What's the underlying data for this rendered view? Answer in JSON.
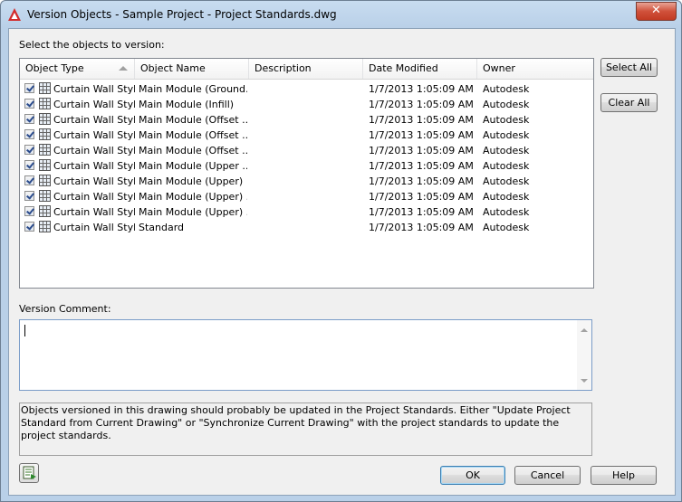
{
  "window": {
    "title": "Version Objects - Sample Project - Project Standards.dwg",
    "close_label": "✕"
  },
  "labels": {
    "select_objects": "Select the objects to version:",
    "version_comment": "Version Comment:"
  },
  "list": {
    "columns": [
      "Object Type",
      "Object Name",
      "Description",
      "Date Modified",
      "Owner"
    ],
    "rows": [
      {
        "type": "Curtain Wall Style",
        "name": "Main Module (Ground…",
        "description": "",
        "date": "1/7/2013 1:05:09 AM",
        "owner": "Autodesk",
        "checked": true
      },
      {
        "type": "Curtain Wall Style",
        "name": "Main Module (Infill)",
        "description": "",
        "date": "1/7/2013 1:05:09 AM",
        "owner": "Autodesk",
        "checked": true
      },
      {
        "type": "Curtain Wall Style",
        "name": "Main Module (Offset ...",
        "description": "",
        "date": "1/7/2013 1:05:09 AM",
        "owner": "Autodesk",
        "checked": true
      },
      {
        "type": "Curtain Wall Style",
        "name": "Main Module (Offset ...",
        "description": "",
        "date": "1/7/2013 1:05:09 AM",
        "owner": "Autodesk",
        "checked": true
      },
      {
        "type": "Curtain Wall Style",
        "name": "Main Module (Offset ...",
        "description": "",
        "date": "1/7/2013 1:05:09 AM",
        "owner": "Autodesk",
        "checked": true
      },
      {
        "type": "Curtain Wall Style",
        "name": "Main Module (Upper ...",
        "description": "",
        "date": "1/7/2013 1:05:09 AM",
        "owner": "Autodesk",
        "checked": true
      },
      {
        "type": "Curtain Wall Style",
        "name": "Main Module (Upper)",
        "description": "",
        "date": "1/7/2013 1:05:09 AM",
        "owner": "Autodesk",
        "checked": true
      },
      {
        "type": "Curtain Wall Style",
        "name": "Main Module (Upper) ...",
        "description": "",
        "date": "1/7/2013 1:05:09 AM",
        "owner": "Autodesk",
        "checked": true
      },
      {
        "type": "Curtain Wall Style",
        "name": "Main Module (Upper) ...",
        "description": "",
        "date": "1/7/2013 1:05:09 AM",
        "owner": "Autodesk",
        "checked": true
      },
      {
        "type": "Curtain Wall Style",
        "name": "Standard",
        "description": "",
        "date": "1/7/2013 1:05:09 AM",
        "owner": "Autodesk",
        "checked": true
      }
    ]
  },
  "buttons": {
    "select_all": "Select All",
    "clear_all": "Clear All",
    "ok": "OK",
    "cancel": "Cancel",
    "help": "Help"
  },
  "comment": {
    "value": ""
  },
  "info_text": "Objects versioned in this drawing should probably be updated in the Project Standards. Either \"Update Project Standard from Current Drawing\" or \"Synchronize Current Drawing\" with the project standards to update the project standards.",
  "colors": {
    "title_bar": "#b9d0e8",
    "close_button": "#c94a33",
    "dialog_bg": "#f0f0f0",
    "app_icon": "#d22b2b"
  },
  "icons": {
    "app": "autocad-a-icon",
    "row": "curtain-wall-style-icon",
    "tool": "properties-icon"
  }
}
